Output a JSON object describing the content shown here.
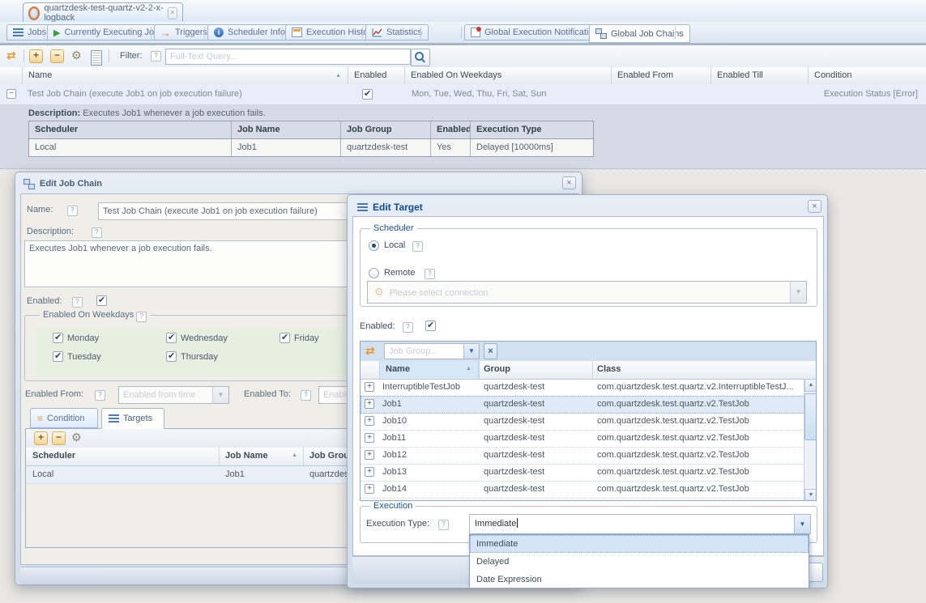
{
  "icons": {
    "close": "×",
    "refresh": "⇄",
    "gear": "⚙",
    "plus": "+",
    "minus": "−",
    "collapse": "−",
    "expand": "+",
    "question": "?",
    "sort_asc": "▲",
    "chevron_down": "▼",
    "info": "i",
    "arrow": "→",
    "clear": "×",
    "play": "▶",
    "up": "▲",
    "down": "▼",
    "bars": "≡"
  },
  "colors": {
    "accent_blue": "#15428b",
    "toolbar_icon_orange": "#e8a33d",
    "weekday_panel_green": "#e7f0e0",
    "selection_blue": "#dfe9f6"
  },
  "browser_tab": {
    "title": "quartzdesk-test-quartz-v2-2-x-logback"
  },
  "nav": {
    "tabs": [
      {
        "label": "Jobs"
      },
      {
        "label": "Currently Executing Jobs"
      },
      {
        "label": "Triggers"
      },
      {
        "label": "Scheduler Info"
      },
      {
        "label": "Execution History"
      },
      {
        "label": "Statistics"
      },
      {
        "label": "Global Execution Notifications"
      },
      {
        "label": "Global Job Chains"
      }
    ],
    "active_tab": "Global Job Chains"
  },
  "toolbar": {
    "filter_label": "Filter:",
    "filter_placeholder": "Full-Text Query..."
  },
  "grid": {
    "columns": [
      "Name",
      "Enabled",
      "Enabled On Weekdays",
      "Enabled From",
      "Enabled Till",
      "Condition"
    ],
    "row": {
      "name": "Test Job Chain (execute Job1 on job execution failure)",
      "enabled": true,
      "weekdays": "Mon, Tue, Wed, Thu, Fri, Sat, Sun",
      "enabled_from": "",
      "enabled_till": "",
      "condition": "Execution Status [Error]"
    },
    "detail": {
      "description_label": "Description:",
      "description": "Executes Job1 whenever a job execution fails.",
      "table": {
        "columns": [
          "Scheduler",
          "Job Name",
          "Job Group",
          "Enabled",
          "Execution Type"
        ],
        "rows": [
          [
            "Local",
            "Job1",
            "quartzdesk-test",
            "Yes",
            "Delayed [10000ms]"
          ]
        ]
      }
    }
  },
  "edit_job_chain": {
    "title": "Edit Job Chain",
    "name_label": "Name:",
    "name_value": "Test Job Chain (execute Job1 on job execution failure)",
    "description_label": "Description:",
    "description_value": "Executes Job1 whenever a job execution fails.",
    "enabled_label": "Enabled:",
    "enabled_checked": true,
    "weekdays_legend": "Enabled On Weekdays",
    "weekdays": [
      {
        "label": "Monday",
        "checked": true
      },
      {
        "label": "Tuesday",
        "checked": true
      },
      {
        "label": "Wednesday",
        "checked": true
      },
      {
        "label": "Thursday",
        "checked": true
      },
      {
        "label": "Friday",
        "checked": true
      }
    ],
    "enabled_from_label": "Enabled From:",
    "enabled_from_placeholder": "Enabled from time",
    "enabled_to_label": "Enabled To:",
    "enabled_to_placeholder": "Enabled to time",
    "tabs": {
      "condition": "Condition",
      "targets": "Targets"
    },
    "targets_table": {
      "columns": [
        "Scheduler",
        "Job Name",
        "Job Group"
      ],
      "rows": [
        [
          "Local",
          "Job1",
          "quartzdesk-test"
        ]
      ]
    }
  },
  "edit_target": {
    "title": "Edit Target",
    "scheduler_legend": "Scheduler",
    "local_label": "Local",
    "remote_label": "Remote",
    "connection_placeholder": "Please select connection",
    "enabled_label": "Enabled:",
    "enabled_checked": true,
    "jobs_filter_placeholder": "Job Group...",
    "jobs_table": {
      "columns": [
        "Name",
        "Group",
        "Class"
      ],
      "rows": [
        [
          "InterruptibleTestJob",
          "quartzdesk-test",
          "com.quartzdesk.test.quartz.v2.InterruptibleTestJ..."
        ],
        [
          "Job1",
          "quartzdesk-test",
          "com.quartzdesk.test.quartz.v2.TestJob"
        ],
        [
          "Job10",
          "quartzdesk-test",
          "com.quartzdesk.test.quartz.v2.TestJob"
        ],
        [
          "Job11",
          "quartzdesk-test",
          "com.quartzdesk.test.quartz.v2.TestJob"
        ],
        [
          "Job12",
          "quartzdesk-test",
          "com.quartzdesk.test.quartz.v2.TestJob"
        ],
        [
          "Job13",
          "quartzdesk-test",
          "com.quartzdesk.test.quartz.v2.TestJob"
        ],
        [
          "Job14",
          "quartzdesk-test",
          "com.quartzdesk.test.quartz.v2.TestJob"
        ]
      ],
      "selected_row_index": 1
    },
    "execution_legend": "Execution",
    "execution_type_label": "Execution Type:",
    "execution_type_value": "Immediate",
    "execution_type_options": [
      "Immediate",
      "Delayed",
      "Date Expression"
    ]
  }
}
